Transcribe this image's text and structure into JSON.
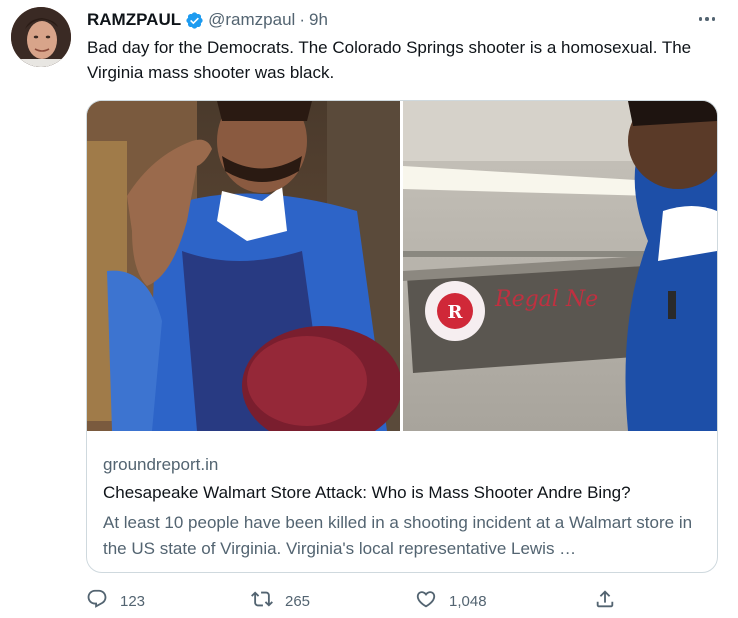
{
  "author": {
    "display_name": "RAMZPAUL",
    "handle": "@ramzpaul",
    "separator": "·",
    "time": "9h",
    "verified_icon": "verified-badge-icon"
  },
  "tweet": {
    "text": "Bad day for the Democrats. The Colorado Springs shooter is a homosexual. The Virginia mass shooter was black."
  },
  "card": {
    "domain": "groundreport.in",
    "title": "Chesapeake Walmart Store Attack: Who is Mass Shooter Andre Bing?",
    "description": "At least 10 people have been killed in a shooting incident at a Walmart store in the US state of Virginia. Virginia's local representative Lewis …",
    "store_sign": "Regal Ne"
  },
  "actions": {
    "reply_count": "123",
    "retweet_count": "265",
    "like_count": "1,048"
  },
  "colors": {
    "text_primary": "#0f1419",
    "text_secondary": "#536471",
    "border": "#cfd9de",
    "verified": "#1d9bf0"
  }
}
